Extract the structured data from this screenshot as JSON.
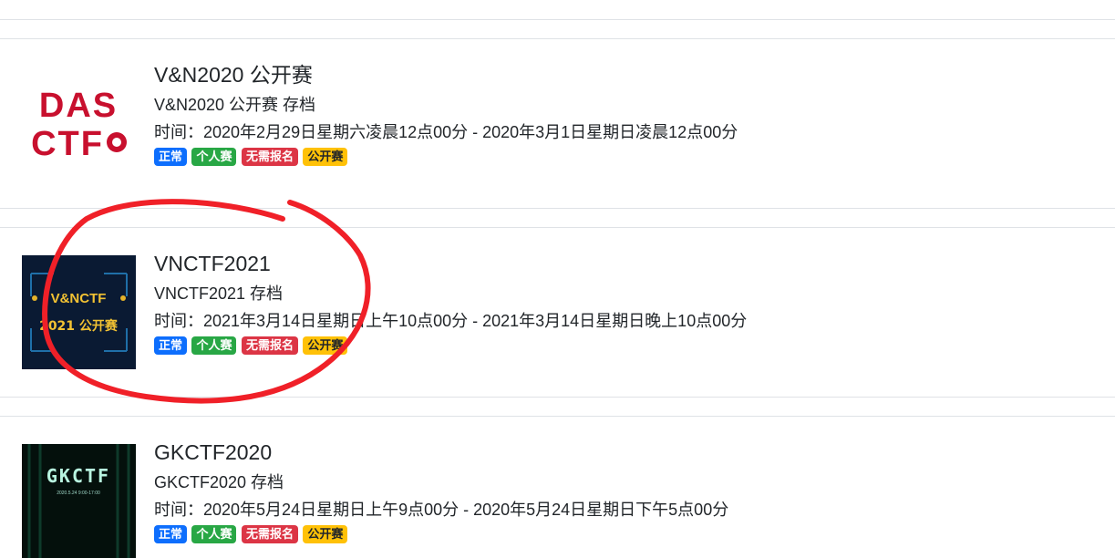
{
  "events": [
    {
      "title": "V&N2020 公开赛",
      "subtitle": "V&N2020 公开赛 存档",
      "time": "时间：2020年2月29日星期六凌晨12点00分 - 2020年3月1日星期日凌晨12点00分",
      "image": {
        "line1": "DAS",
        "line2": "CTF"
      },
      "tags": [
        "正常",
        "个人赛",
        "无需报名",
        "公开赛"
      ]
    },
    {
      "title": "VNCTF2021",
      "subtitle": "VNCTF2021 存档",
      "time": "时间：2021年3月14日星期日上午10点00分 - 2021年3月14日星期日晚上10点00分",
      "image": {
        "line1": "V&NCTF",
        "line2": "2021 公开赛"
      },
      "tags": [
        "正常",
        "个人赛",
        "无需报名",
        "公开赛"
      ]
    },
    {
      "title": "GKCTF2020",
      "subtitle": "GKCTF2020 存档",
      "time": "时间：2020年5月24日星期日上午9点00分 - 2020年5月24日星期日下午5点00分",
      "image": {
        "line1": "GKCTF",
        "line2": "2020.5.24 9:00-17:00"
      },
      "tags": [
        "正常",
        "个人赛",
        "无需报名",
        "公开赛"
      ]
    }
  ],
  "colors": {
    "blue": "#0d6efd",
    "green": "#28a745",
    "red": "#dc3545",
    "yellow": "#ffc107",
    "annotation": "#f02028"
  }
}
